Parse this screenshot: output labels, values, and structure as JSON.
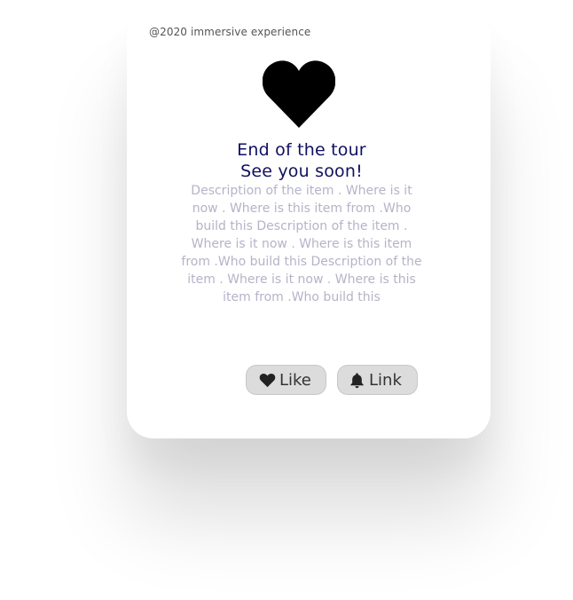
{
  "card": {
    "copyright": "@2020 immersive experience",
    "heart_icon": "heart-icon",
    "title_line1": "End of the tour",
    "title_line2": "See you soon!",
    "description": "Description of the item . Where is it now . Where is this item from .Who build this Description of the item . Where is it now . Where is this item from .Who build this Description of the item . Where is it now . Where is this item from .Who build this"
  },
  "buttons": {
    "like_label": "Like",
    "like_icon": "heart-icon",
    "link_label": "Link",
    "link_icon": "bell-icon"
  },
  "colors": {
    "title": "#101060",
    "description": "#b4b4c8",
    "button_bg": "#dcdcdc"
  }
}
